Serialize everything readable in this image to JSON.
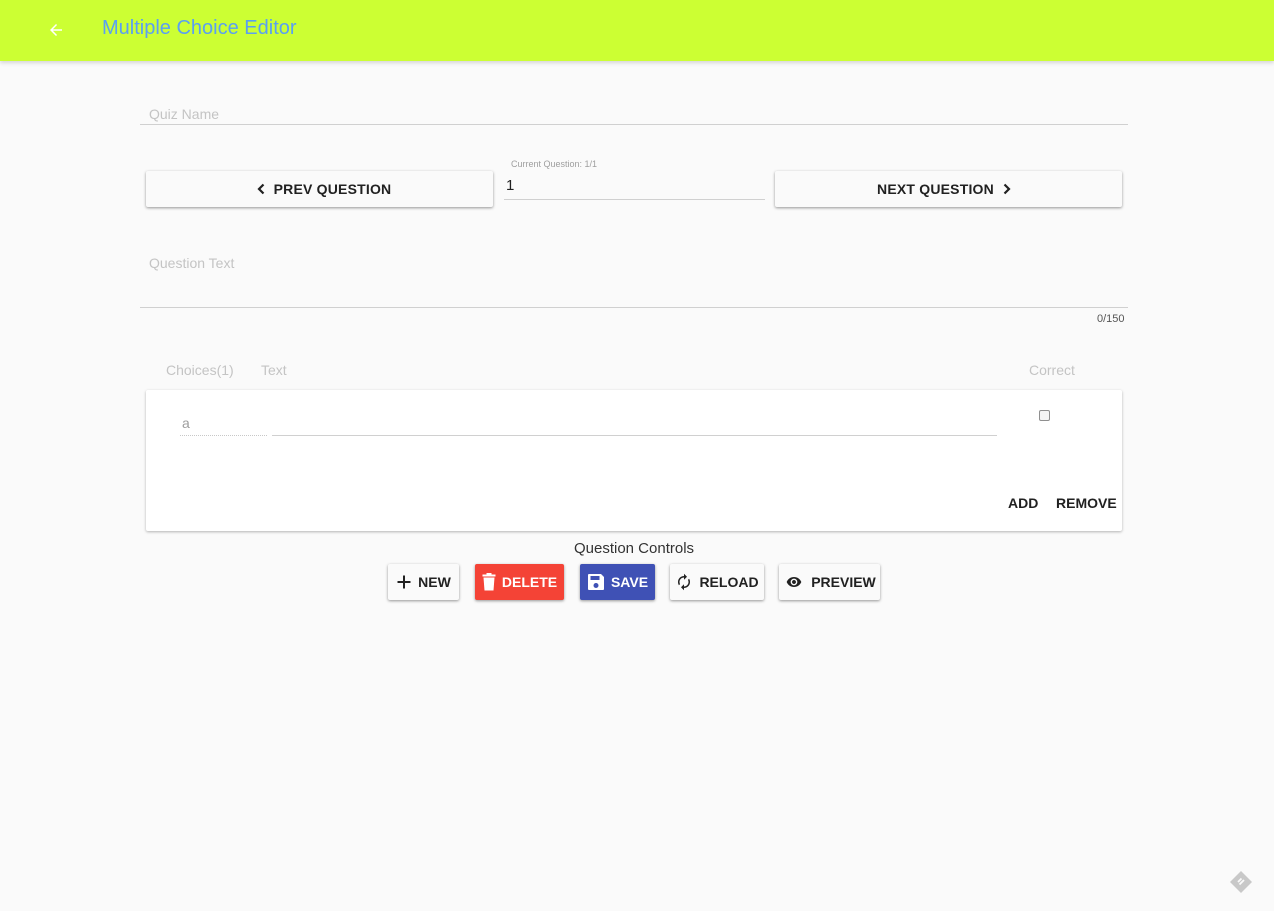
{
  "app": {
    "title": "Multiple Choice Editor",
    "bar_color": "#ccff33",
    "title_color": "#5aa0f2"
  },
  "quiz_name": {
    "placeholder": "Quiz Name",
    "value": ""
  },
  "navigation": {
    "prev_label": "PREV QUESTION",
    "next_label": "NEXT QUESTION",
    "current_question_label": "Current Question: 1/1",
    "current_question_value": "1"
  },
  "question_text": {
    "placeholder": "Question Text",
    "value": "",
    "counter": "0/150"
  },
  "choices": {
    "header_choices": "Choices(1)",
    "header_text": "Text",
    "header_correct": "Correct",
    "items": [
      {
        "letter": "a",
        "text": "",
        "correct": false
      }
    ],
    "add_label": "ADD",
    "remove_label": "REMOVE"
  },
  "controls": {
    "title": "Question Controls",
    "new_label": "NEW",
    "delete_label": "DELETE",
    "save_label": "SAVE",
    "reload_label": "RELOAD",
    "preview_label": "PREVIEW",
    "delete_color": "#f44336",
    "save_color": "#3f51b5"
  },
  "icons": {
    "back": "arrow-left-icon",
    "prev": "chevron-left-icon",
    "next": "chevron-right-icon",
    "new": "plus-icon",
    "delete": "trash-icon",
    "save": "floppy-disk-icon",
    "reload": "refresh-icon",
    "preview": "eye-icon",
    "corner": "diamond-badge-icon"
  }
}
